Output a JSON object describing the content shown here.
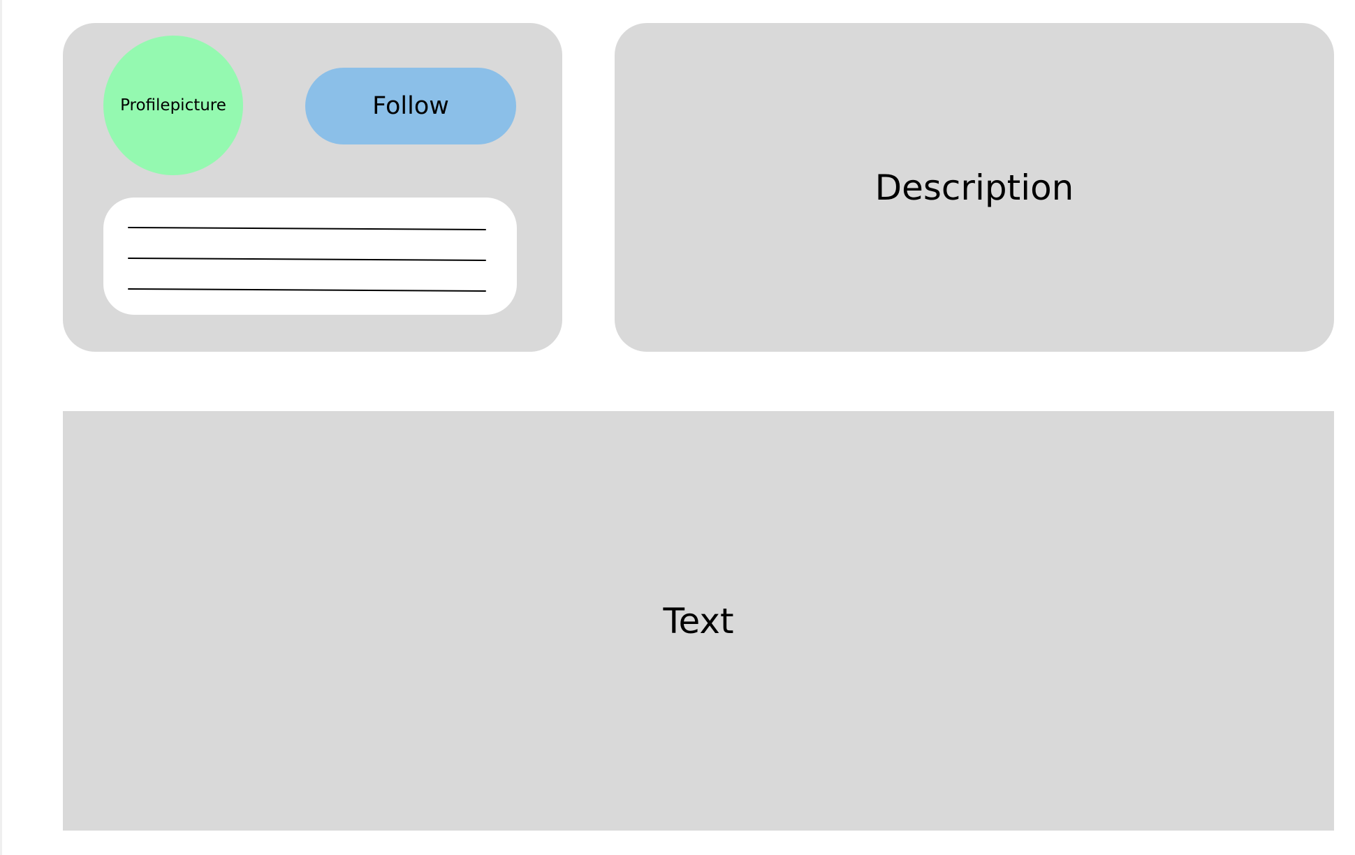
{
  "profile_card": {
    "avatar_label": "Profilepicture",
    "follow_label": "Follow"
  },
  "description_panel": {
    "label": "Description"
  },
  "text_panel": {
    "label": "Text"
  },
  "colors": {
    "panel": "#d9d9d9",
    "avatar": "#94f9b0",
    "follow_button": "#8bbfe8",
    "inner_box": "#ffffff",
    "text": "#000000"
  }
}
